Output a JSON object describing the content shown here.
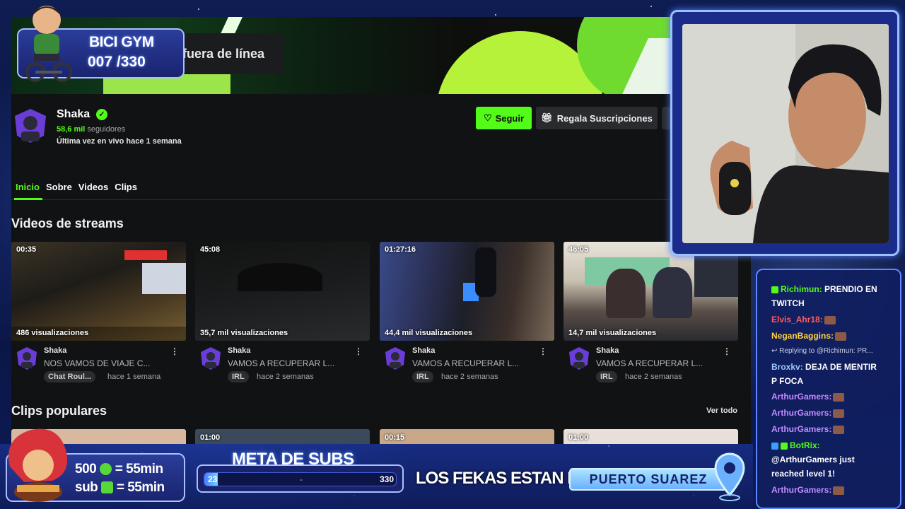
{
  "channel": {
    "offline_label": "fuera de línea",
    "name": "Shaka",
    "followers_count": "58,6 mil",
    "followers_label": "seguidores",
    "last_live": "Última vez en vivo hace 1 semana",
    "follow_label": "Seguir",
    "gift_label": "Regala Suscripciones"
  },
  "tabs": [
    "Inicio",
    "Sobre",
    "Videos",
    "Clips"
  ],
  "sections": {
    "videos_title": "Videos de streams",
    "clips_title": "Clips populares",
    "see_all": "Ver todo"
  },
  "videos": [
    {
      "duration": "00:35",
      "views": "486 visualizaciones",
      "channel": "Shaka",
      "title": "NOS VAMOS DE VIAJE C...",
      "tag": "Chat Roul...",
      "ago": "hace 1 semana"
    },
    {
      "duration": "45:08",
      "views": "35,7 mil visualizaciones",
      "channel": "Shaka",
      "title": "VAMOS A RECUPERAR L...",
      "tag": "IRL",
      "ago": "hace 2 semanas"
    },
    {
      "duration": "01:27:16",
      "views": "44,4 mil visualizaciones",
      "channel": "Shaka",
      "title": "VAMOS A RECUPERAR L...",
      "tag": "IRL",
      "ago": "hace 2 semanas"
    },
    {
      "duration": "46:05",
      "views": "14,7 mil visualizaciones",
      "channel": "Shaka",
      "title": "VAMOS A RECUPERAR L...",
      "tag": "IRL",
      "ago": "hace 2 semanas"
    }
  ],
  "clips": [
    {
      "duration": ""
    },
    {
      "duration": "01:00"
    },
    {
      "duration": "00:15"
    },
    {
      "duration": "01:00"
    }
  ],
  "overlay": {
    "bici_title": "BICI GYM",
    "bici_count": "007 /330",
    "promo_line1": "500",
    "promo_line1_rest": "= 55min",
    "promo_line2": "sub",
    "promo_line2_rest": "= 55min",
    "meta_title": "META DE SUBS",
    "meta_min": "23",
    "meta_max": "330",
    "meta_sep": "-",
    "meta_progress": 0.07,
    "fekas_label": "LOS FEKAS ESTAN EN:",
    "location": "PUERTO SUAREZ"
  },
  "chat": [
    {
      "user": "Richimun:",
      "text": "PRENDIO EN",
      "color": "green"
    },
    {
      "user": "",
      "text": "TWITCH",
      "color": ""
    },
    {
      "user": "Elvis_Ahr18:",
      "text": "",
      "color": "red",
      "emote": true
    },
    {
      "user": "NeganBaggins:",
      "text": "",
      "color": "yellow",
      "emote": true
    },
    {
      "user": "",
      "text": "Replying to @Richimun: PR...",
      "color": "",
      "reply": true
    },
    {
      "user": "Broxkv:",
      "text": "DEJA DE MENTIR",
      "color": "blue"
    },
    {
      "user": "",
      "text": "P FOCA",
      "color": ""
    },
    {
      "user": "ArthurGamers:",
      "text": "",
      "color": "purple",
      "emote": true
    },
    {
      "user": "ArthurGamers:",
      "text": "",
      "color": "purple",
      "emote": true
    },
    {
      "user": "ArthurGamers:",
      "text": "",
      "color": "purple",
      "emote": true
    },
    {
      "user": "BotRix:",
      "text": "",
      "color": "green"
    },
    {
      "user": "",
      "text": "@ArthurGamers just",
      "color": ""
    },
    {
      "user": "",
      "text": "reached level 1!",
      "color": ""
    },
    {
      "user": "ArthurGamers:",
      "text": "",
      "color": "purple",
      "emote": true
    }
  ],
  "colors": {
    "accent": "#53fc18",
    "page_bg": "#111213",
    "overlay_blue": "#1a2470"
  }
}
